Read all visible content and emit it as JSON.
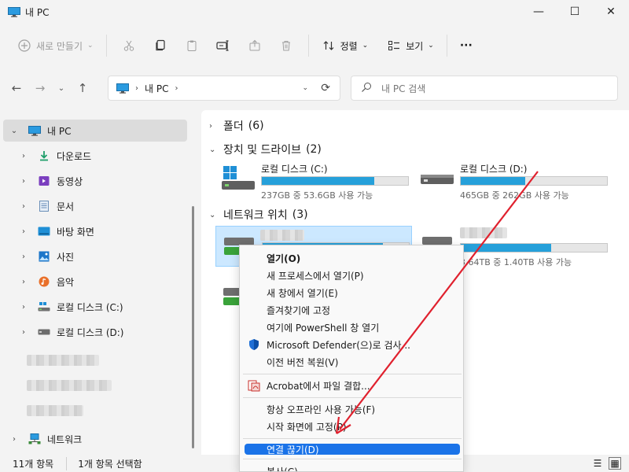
{
  "window": {
    "title": "내 PC",
    "minimize": "—",
    "maximize": "☐",
    "close": "✕"
  },
  "commandbar": {
    "new_label": "새로 만들기",
    "sort_label": "정렬",
    "view_label": "보기",
    "more_label": "···"
  },
  "address": {
    "location": "내 PC"
  },
  "search": {
    "placeholder": "내 PC 검색"
  },
  "nav": {
    "items": [
      {
        "label": "내 PC",
        "icon": "pc-icon"
      },
      {
        "label": "다운로드",
        "icon": "download-icon"
      },
      {
        "label": "동영상",
        "icon": "video-icon"
      },
      {
        "label": "문서",
        "icon": "document-icon"
      },
      {
        "label": "바탕 화면",
        "icon": "desktop-icon"
      },
      {
        "label": "사진",
        "icon": "pictures-icon"
      },
      {
        "label": "음악",
        "icon": "music-icon"
      },
      {
        "label": "로컬 디스크 (C:)",
        "icon": "windows-drive-icon"
      },
      {
        "label": "로컬 디스크 (D:)",
        "icon": "drive-icon"
      },
      {
        "label": "네트워크",
        "icon": "network-icon"
      }
    ]
  },
  "content": {
    "groups": [
      {
        "label": "폴더",
        "count": "(6)"
      },
      {
        "label": "장치 및 드라이브",
        "count": "(2)"
      },
      {
        "label": "네트워크 위치",
        "count": "(3)"
      }
    ],
    "drives": [
      {
        "name": "로컬 디스크 (C:)",
        "size": "237GB 중 53.6GB 사용 가능",
        "used_fraction": 0.77
      },
      {
        "name": "로컬 디스크 (D:)",
        "size": "465GB 중 262GB 사용 가능",
        "used_fraction": 0.44
      }
    ],
    "network_size_partial": "3.64TB 중 1.40TB 사용 가능",
    "network_used_fraction": 0.62
  },
  "status": {
    "count": "11개 항목",
    "selected": "1개 항목 선택함"
  },
  "context_menu": {
    "items": [
      {
        "label": "열기(O)"
      },
      {
        "label": "새 프로세스에서 열기(P)"
      },
      {
        "label": "새 창에서 열기(E)"
      },
      {
        "label": "즐겨찾기에 고정"
      },
      {
        "label": "여기에 PowerShell 창 열기"
      },
      {
        "label": "Microsoft Defender(으)로 검사..."
      },
      {
        "label": "이전 버전 복원(V)"
      },
      {
        "label": "Acrobat에서 파일 결합..."
      },
      {
        "label": "항상 오프라인 사용 가능(F)"
      },
      {
        "label": "시작 화면에 고정(P)"
      },
      {
        "label": "연결 끊기(D)"
      },
      {
        "label": "복사(C)"
      }
    ]
  },
  "colors": {
    "accent": "#1a73e8",
    "drive_bar": "#26a0da",
    "arrow": "#e0212e"
  }
}
